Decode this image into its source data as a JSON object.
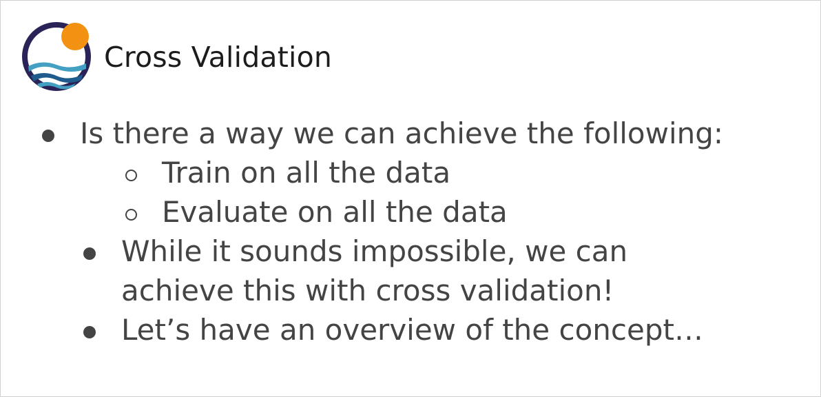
{
  "slide": {
    "title": "Cross Validation",
    "bullets": [
      {
        "level": 1,
        "text": "Is there a way we can achieve the following:"
      },
      {
        "level": 2,
        "text": "Train on all the data"
      },
      {
        "level": 2,
        "text": "Evaluate on all the data"
      },
      {
        "level": 1,
        "text_line1": "While it sounds impossible, we can",
        "text_line2": "achieve this with cross validation!"
      },
      {
        "level": 1,
        "text": "Let’s have an overview of the concept…"
      }
    ]
  },
  "logo": {
    "icon": "sun-over-waves-logo",
    "colors": {
      "ring": "#2a2358",
      "sun": "#f29112",
      "wave_light": "#43a0c3",
      "wave_dark": "#1f5b8c"
    }
  }
}
